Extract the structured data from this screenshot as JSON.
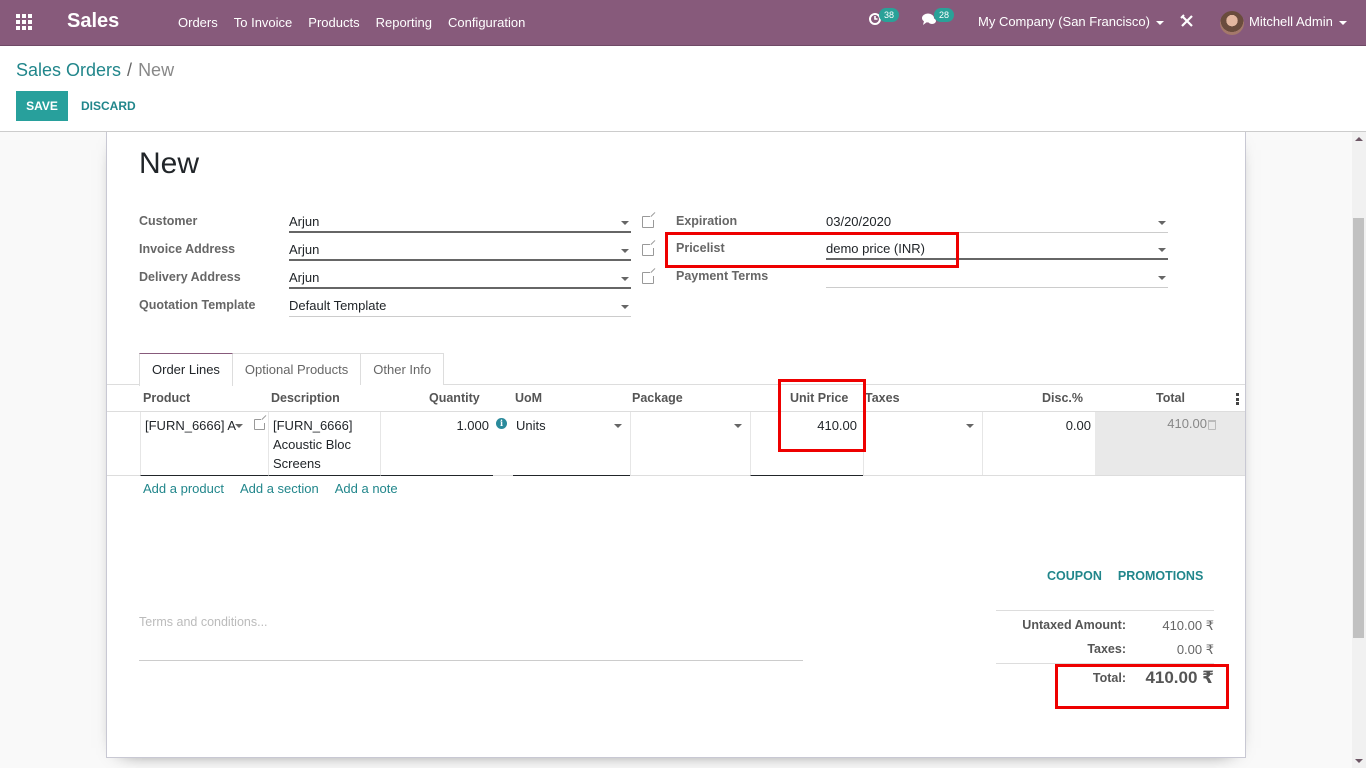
{
  "navbar": {
    "app_name": "Sales",
    "menu": [
      "Orders",
      "To Invoice",
      "Products",
      "Reporting",
      "Configuration"
    ],
    "activity_count": "38",
    "message_count": "28",
    "company": "My Company (San Francisco)",
    "user": "Mitchell Admin",
    "debug_icon": "✕",
    "colors": {
      "brand": "#875a7b",
      "badge": "#2aa198"
    }
  },
  "control_panel": {
    "breadcrumb_parent": "Sales Orders",
    "breadcrumb_separator": "/",
    "breadcrumb_current": "New",
    "save_label": "SAVE",
    "discard_label": "DISCARD"
  },
  "form": {
    "title": "New",
    "left_fields": [
      {
        "label": "Customer",
        "value": "Arjun"
      },
      {
        "label": "Invoice Address",
        "value": "Arjun"
      },
      {
        "label": "Delivery Address",
        "value": "Arjun"
      },
      {
        "label": "Quotation Template",
        "value": "Default Template"
      }
    ],
    "right_fields": [
      {
        "label": "Expiration",
        "value": "03/20/2020"
      },
      {
        "label": "Pricelist",
        "value": "demo price (INR)"
      },
      {
        "label": "Payment Terms",
        "value": ""
      }
    ],
    "tabs": [
      "Order Lines",
      "Optional Products",
      "Other Info"
    ],
    "active_tab": "Order Lines",
    "columns": [
      "Product",
      "Description",
      "Quantity",
      "UoM",
      "Package",
      "Unit Price",
      "Taxes",
      "Disc.%",
      "Total"
    ],
    "lines": [
      {
        "product": "[FURN_6666] A",
        "description": "[FURN_6666] Acoustic Bloc Screens",
        "description_lines": [
          "[FURN_6666]",
          "Acoustic Bloc",
          "Screens"
        ],
        "quantity": "1.000",
        "uom": "Units",
        "package": "",
        "unit_price": "410.00",
        "taxes": "",
        "discount": "0.00",
        "total": "410.00"
      }
    ],
    "add_links": [
      "Add a product",
      "Add a section",
      "Add a note"
    ],
    "coupon_label": "COUPON",
    "promotions_label": "PROMOTIONS",
    "terms_placeholder": "Terms and conditions...",
    "totals": {
      "untaxed_label": "Untaxed Amount:",
      "untaxed_value": "410.00 ₹",
      "taxes_label": "Taxes:",
      "taxes_value": "0.00 ₹",
      "total_label": "Total:",
      "total_value": "410.00 ₹"
    }
  }
}
